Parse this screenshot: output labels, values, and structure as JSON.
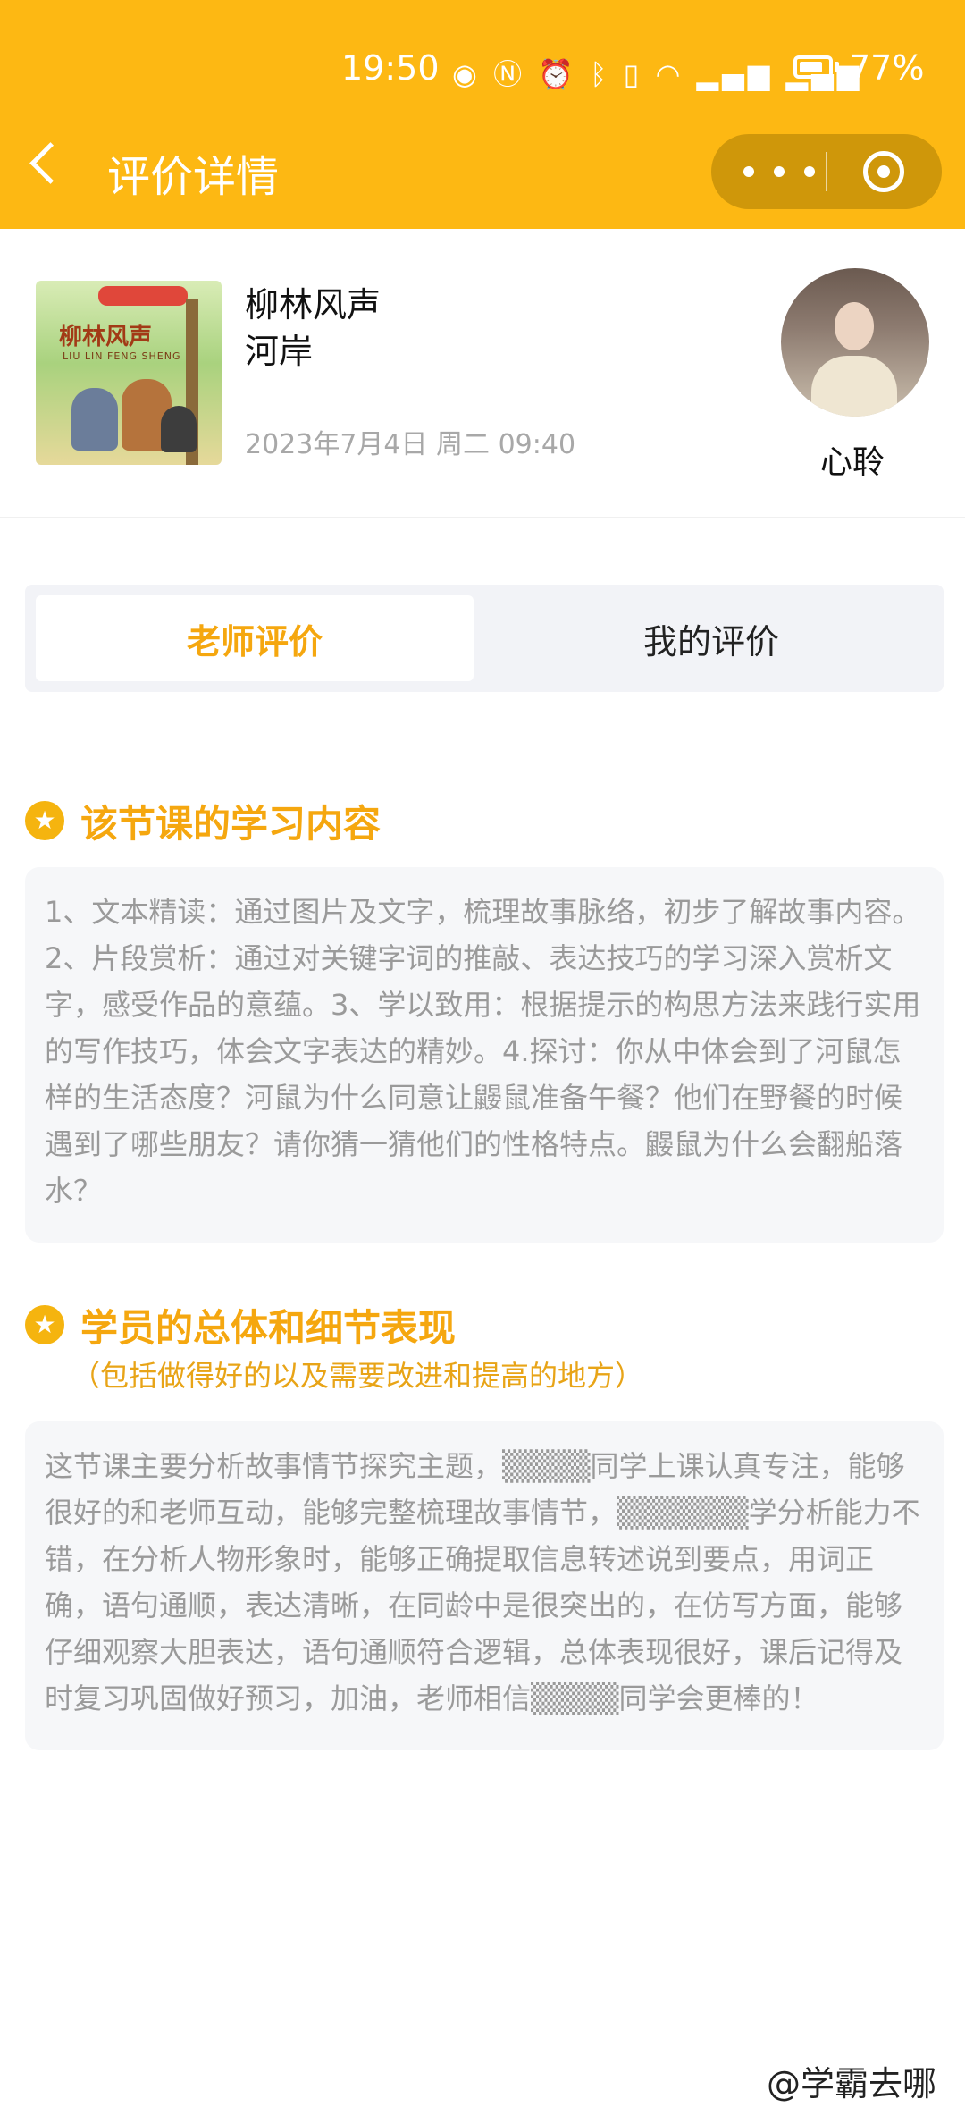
{
  "status_bar": {
    "time": "19:50",
    "icons": [
      "eye-icon",
      "nfc-icon",
      "alarm-icon",
      "bluetooth-icon",
      "vibrate-icon",
      "wifi-icon",
      "signal-4g-icon",
      "signal-4g-icon",
      "battery-icon"
    ],
    "battery": "77%",
    "battery_level": 0.77
  },
  "header": {
    "title": "评价详情",
    "background": "#FDB813"
  },
  "book": {
    "name": "柳林风声",
    "author": "河岸",
    "datetime": "2023年7月4日 周二 09:40",
    "cover_title": "柳林风声",
    "cover_subtitle": "LIU LIN FENG SHENG"
  },
  "teacher": {
    "name": "心聆"
  },
  "tabs": [
    {
      "label": "老师评价",
      "active": true
    },
    {
      "label": "我的评价",
      "active": false
    }
  ],
  "sections": {
    "content": {
      "title": "该节课的学习内容",
      "text": "1、文本精读：通过图片及文字，梳理故事脉络，初步了解故事内容。2、片段赏析：通过对关键字词的推敲、表达技巧的学习深入赏析文字，感受作品的意蕴。3、学以致用：根据提示的构思方法来践行实用的写作技巧，体会文字表达的精妙。4.探讨：你从中体会到了河鼠怎样的生活态度？河鼠为什么同意让鼹鼠准备午餐？他们在野餐的时候遇到了哪些朋友？请你猜一猜他们的性格特点。鼹鼠为什么会翻船落水？"
    },
    "performance": {
      "title": "学员的总体和细节表现",
      "subtitle": "（包括做得好的以及需要改进和提高的地方）",
      "text": "这节课主要分析故事情节探究主题，▒▒▒▒同学上课认真专注，能够很好的和老师互动，能够完整梳理故事情节，▒▒▒▒▒▒学分析能力不错，在分析人物形象时，能够正确提取信息转述说到要点，用词正确，语句通顺，表达清晰，在同龄中是很突出的，在仿写方面，能够仔细观察大胆表达，语句通顺符合逻辑，总体表现很好，课后记得及时复习巩固做好预习，加油，老师相信▒▒▒▒同学会更棒的！"
    }
  },
  "watermark": "@学霸去哪",
  "colors": {
    "accent": "#F5A70F",
    "header": "#FDB813",
    "card_bg": "#f6f7f9",
    "muted_text": "#9a9a9a"
  }
}
